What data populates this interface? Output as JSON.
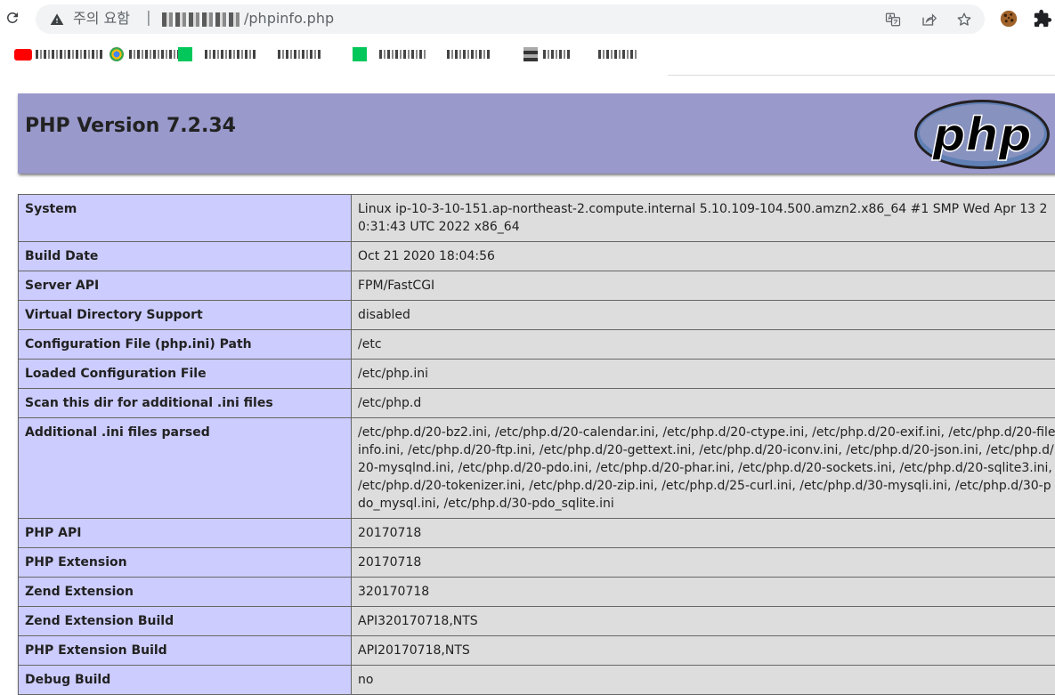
{
  "browser": {
    "security_label": "주의 요함",
    "url_separator": "|",
    "url_path": "/phpinfo.php",
    "icons": [
      "reload-icon",
      "warning-icon",
      "translate-icon",
      "share-icon",
      "star-icon",
      "cookie-extension-icon",
      "puzzle-extension-icon"
    ]
  },
  "php": {
    "title": "PHP Version 7.2.34",
    "logo_text": "php",
    "header_color": "#9999cc",
    "key_color": "#ccccff",
    "value_color": "#dddddd"
  },
  "rows": [
    {
      "key": "System",
      "value": "Linux ip-10-3-10-151.ap-northeast-2.compute.internal 5.10.109-104.500.amzn2.x86_64 #1 SMP Wed Apr 13 20:31:43 UTC 2022 x86_64"
    },
    {
      "key": "Build Date",
      "value": "Oct 21 2020 18:04:56"
    },
    {
      "key": "Server API",
      "value": "FPM/FastCGI"
    },
    {
      "key": "Virtual Directory Support",
      "value": "disabled"
    },
    {
      "key": "Configuration File (php.ini) Path",
      "value": "/etc"
    },
    {
      "key": "Loaded Configuration File",
      "value": "/etc/php.ini"
    },
    {
      "key": "Scan this dir for additional .ini files",
      "value": "/etc/php.d"
    },
    {
      "key": "Additional .ini files parsed",
      "value": "/etc/php.d/20-bz2.ini, /etc/php.d/20-calendar.ini, /etc/php.d/20-ctype.ini, /etc/php.d/20-exif.ini, /etc/php.d/20-fileinfo.ini, /etc/php.d/20-ftp.ini, /etc/php.d/20-gettext.ini, /etc/php.d/20-iconv.ini, /etc/php.d/20-json.ini, /etc/php.d/20-mysqlnd.ini, /etc/php.d/20-pdo.ini, /etc/php.d/20-phar.ini, /etc/php.d/20-sockets.ini, /etc/php.d/20-sqlite3.ini, /etc/php.d/20-tokenizer.ini, /etc/php.d/20-zip.ini, /etc/php.d/25-curl.ini, /etc/php.d/30-mysqli.ini, /etc/php.d/30-pdo_mysql.ini, /etc/php.d/30-pdo_sqlite.ini"
    },
    {
      "key": "PHP API",
      "value": "20170718"
    },
    {
      "key": "PHP Extension",
      "value": "20170718"
    },
    {
      "key": "Zend Extension",
      "value": "320170718"
    },
    {
      "key": "Zend Extension Build",
      "value": "API320170718,NTS"
    },
    {
      "key": "PHP Extension Build",
      "value": "API20170718,NTS"
    },
    {
      "key": "Debug Build",
      "value": "no"
    }
  ]
}
